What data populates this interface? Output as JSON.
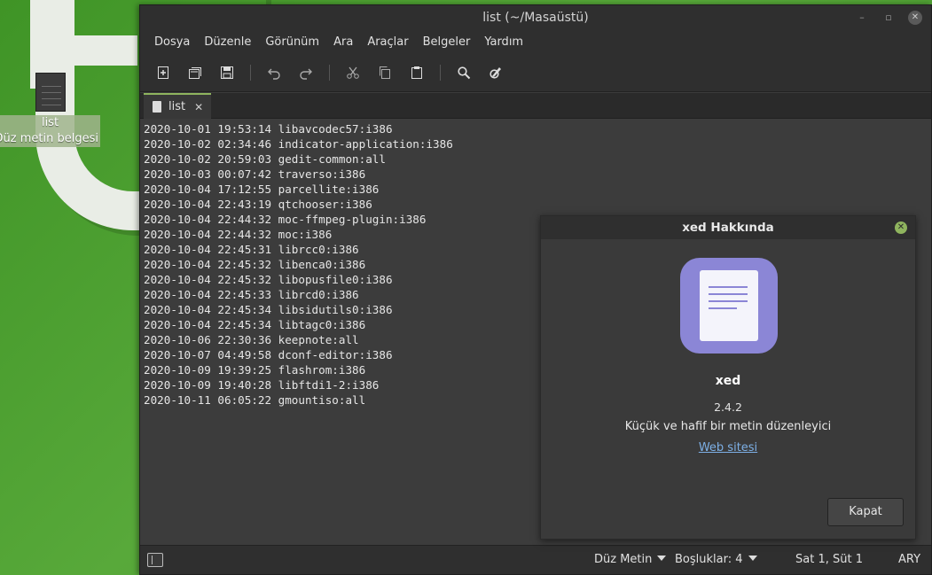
{
  "desktop": {
    "icon": {
      "name": "list",
      "type": "Düz metin belgesi"
    }
  },
  "window": {
    "title": "list (~/Masaüstü)",
    "menu": [
      "Dosya",
      "Düzenle",
      "Görünüm",
      "Ara",
      "Araçlar",
      "Belgeler",
      "Yardım"
    ],
    "toolbar": [
      "new-document-icon",
      "new-window-icon",
      "save-icon",
      "undo-icon",
      "redo-icon",
      "cut-icon",
      "copy-icon",
      "paste-icon",
      "search-icon",
      "replace-icon"
    ],
    "tab": {
      "label": "list"
    },
    "lines": [
      "2020-10-01 19:53:14 libavcodec57:i386",
      "2020-10-02 02:34:46 indicator-application:i386",
      "2020-10-02 20:59:03 gedit-common:all",
      "2020-10-03 00:07:42 traverso:i386",
      "2020-10-04 17:12:55 parcellite:i386",
      "2020-10-04 22:43:19 qtchooser:i386",
      "2020-10-04 22:44:32 moc-ffmpeg-plugin:i386",
      "2020-10-04 22:44:32 moc:i386",
      "2020-10-04 22:45:31 librcc0:i386",
      "2020-10-04 22:45:32 libenca0:i386",
      "2020-10-04 22:45:32 libopusfile0:i386",
      "2020-10-04 22:45:33 librcd0:i386",
      "2020-10-04 22:45:34 libsidutils0:i386",
      "2020-10-04 22:45:34 libtagc0:i386",
      "2020-10-06 22:30:36 keepnote:all",
      "2020-10-07 04:49:58 dconf-editor:i386",
      "2020-10-09 19:39:25 flashrom:i386",
      "2020-10-09 19:40:28 libftdi1-2:i386",
      "2020-10-11 06:05:22 gmountiso:all"
    ],
    "status": {
      "language": "Düz Metin",
      "tab_width": "Boşluklar: 4",
      "cursor": "Sat 1, Süt 1",
      "mode": "ARY"
    }
  },
  "about": {
    "title": "xed Hakkında",
    "app_name": "xed",
    "version": "2.4.2",
    "description": "Küçük ve hafif bir metin düzenleyici",
    "website": "Web sitesi",
    "close_label": "Kapat"
  },
  "colors": {
    "accent": "#8fb45e",
    "logo": "#8b86d6",
    "link": "#7db0e6"
  }
}
